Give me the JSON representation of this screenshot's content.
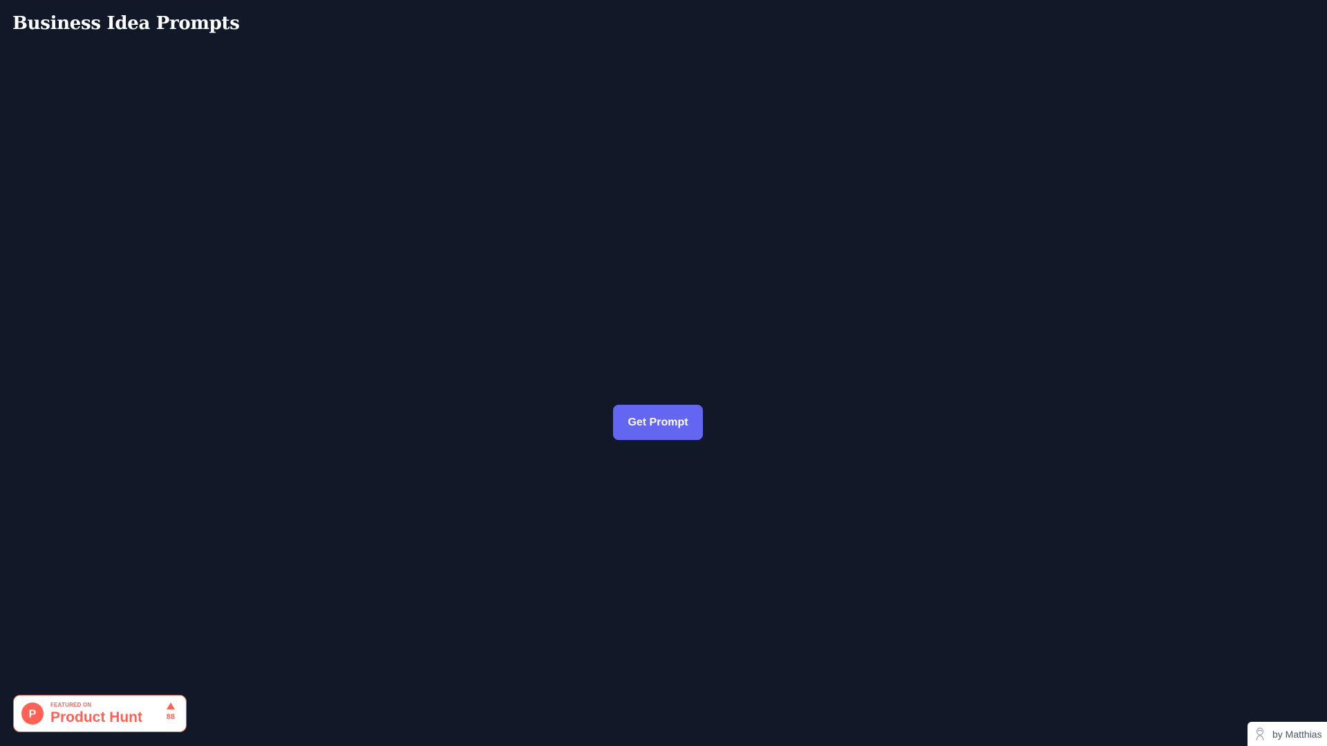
{
  "header": {
    "title": "Business Idea Prompts"
  },
  "main": {
    "get_prompt_label": "Get Prompt",
    "button_color": "#6366f1"
  },
  "product_hunt_badge": {
    "featured_label": "FEATURED ON",
    "name": "Product Hunt",
    "upvotes": "88",
    "logo_letter": "P",
    "brand_color": "#ff6154",
    "icon": "product-hunt-logo-icon"
  },
  "author": {
    "label": "by Matthias",
    "icon": "avatar-sketch-icon"
  },
  "colors": {
    "background": "#111827",
    "title_text": "#ffffff"
  }
}
